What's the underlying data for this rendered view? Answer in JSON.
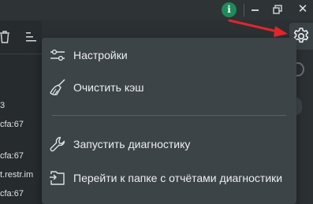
{
  "window": {
    "info_glyph": "i",
    "close_glyph": "✕"
  },
  "left_pane": {
    "lines": [
      "3",
      "cfa:67",
      "cfa:67",
      "t.restr.im",
      "cfa:67"
    ]
  },
  "settings_menu": {
    "items": [
      {
        "label": "Настройки",
        "icon": "sliders-icon"
      },
      {
        "label": "Очистить кэш",
        "icon": "broom-icon"
      },
      {
        "label": "Запустить диагностику",
        "icon": "wrench-icon"
      },
      {
        "label": "Перейти к папке с отчётами диагностики",
        "icon": "folder-export-icon"
      }
    ]
  },
  "colors": {
    "background": "#2b3033",
    "menu_background": "#3d4448",
    "annotation_arrow": "#e0262b",
    "info_badge": "#1f8a5b"
  }
}
